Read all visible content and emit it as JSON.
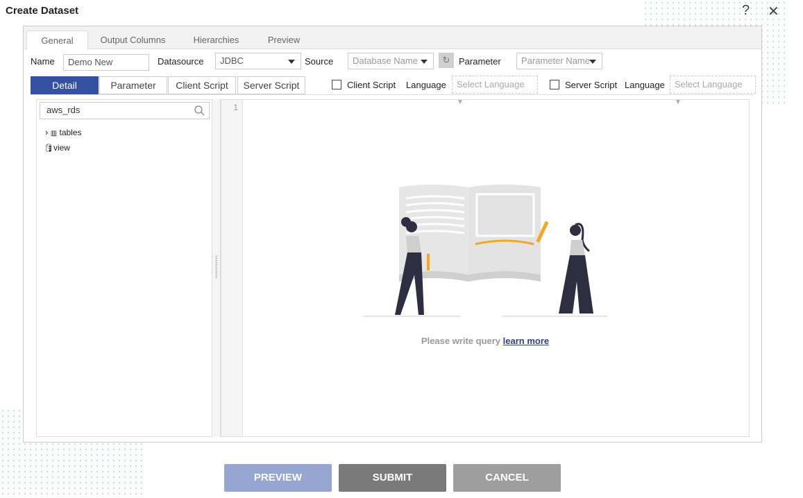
{
  "dialog": {
    "title": "Create Dataset",
    "help_icon": "question-icon",
    "close_icon": "close-icon"
  },
  "tabs": [
    {
      "label": "General",
      "active": true
    },
    {
      "label": "Output Columns"
    },
    {
      "label": "Hierarchies"
    },
    {
      "label": "Preview"
    }
  ],
  "form": {
    "name_label": "Name",
    "name_value": "Demo New",
    "datasource_label": "Datasource",
    "datasource_value": "JDBC",
    "source_label": "Source",
    "source_placeholder": "Database Name",
    "parameter_label": "Parameter",
    "parameter_placeholder": "Parameter Name"
  },
  "subtabs": [
    {
      "label": "Detail",
      "active": true
    },
    {
      "label": "Parameter"
    },
    {
      "label": "Client Script"
    },
    {
      "label": "Server Script"
    }
  ],
  "scripts": {
    "client_label": "Client Script",
    "client_language_label": "Language",
    "client_language_placeholder": "Select Language",
    "client_checked": false,
    "server_label": "Server Script",
    "server_language_label": "Language",
    "server_language_placeholder": "Select Language",
    "server_checked": false
  },
  "tree": {
    "search_value": "aws_rds",
    "items": [
      {
        "label": "tables",
        "icon": "table-icon",
        "expandable": true
      },
      {
        "label": "view",
        "icon": "database-icon"
      }
    ]
  },
  "editor": {
    "line_number": "1",
    "empty_text": "Please write query",
    "learn_more": "learn more"
  },
  "buttons": {
    "preview": "PREVIEW",
    "submit": "SUBMIT",
    "cancel": "CANCEL"
  },
  "colors": {
    "accent": "#3451a1",
    "preview": "#97a6d1",
    "submit": "#7a7a7a",
    "cancel": "#9e9e9e",
    "link": "#2a3f8f",
    "illustration_accent": "#f5a623"
  }
}
